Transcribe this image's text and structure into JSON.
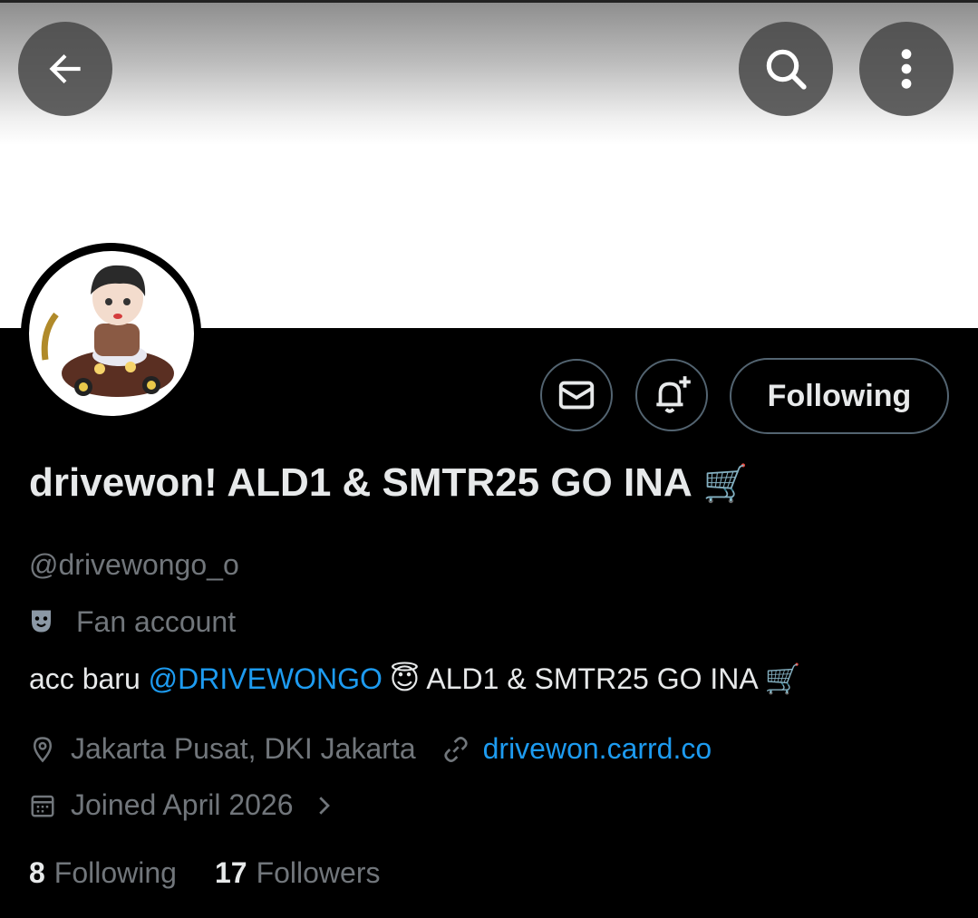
{
  "header": {
    "back_icon": "arrow-left-icon",
    "search_icon": "search-icon",
    "more_icon": "more-vertical-icon"
  },
  "profile": {
    "display_name": "drivewon! ALD1 & SMTR25 GO INA",
    "display_name_emoji": "🛒",
    "handle": "@drivewongo_o",
    "category": "Fan account",
    "bio": {
      "prefix": "acc baru ",
      "mention": "@DRIVEWONGO",
      "emoji1": "😇",
      "suffix": " ALD1 & SMTR25 GO INA ",
      "emoji2": "🛒"
    },
    "location": "Jakarta Pusat, DKI Jakarta",
    "website": "drivewon.carrd.co",
    "joined": "Joined April 2026"
  },
  "actions": {
    "follow_label": "Following"
  },
  "stats": {
    "following_count": "8",
    "following_label": "Following",
    "followers_count": "17",
    "followers_label": "Followers"
  },
  "colors": {
    "background": "#000000",
    "text_primary": "#e7e9ea",
    "text_secondary": "#71767b",
    "link": "#1d9bf0",
    "border": "#536471"
  }
}
